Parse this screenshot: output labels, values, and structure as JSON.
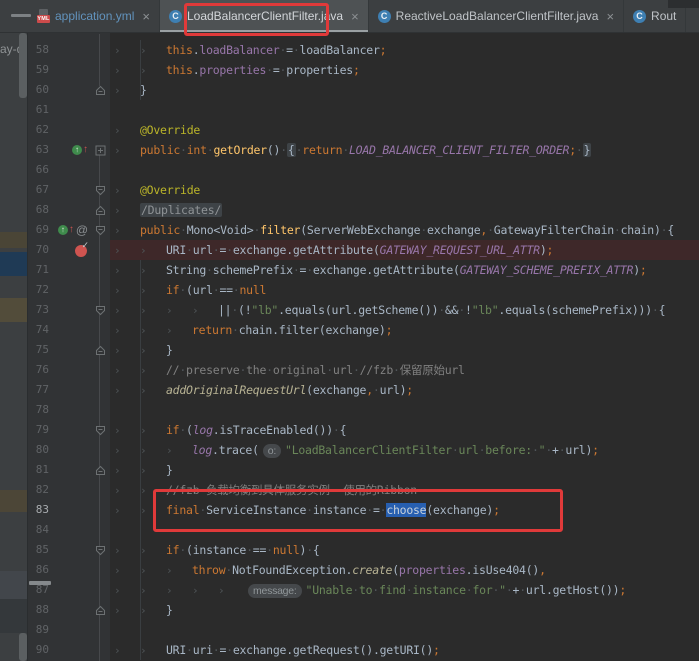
{
  "tab_bar": {
    "class_badge": "C",
    "yml_badge": "YML",
    "close_glyph": "×",
    "tabs": [
      {
        "id": "application-yml",
        "label": "application.yml",
        "icon": "yml-file-icon",
        "state": "modified",
        "closable": true
      },
      {
        "id": "load-balancer-client-filter",
        "label": "LoadBalancerClientFilter.java",
        "icon": "java-class-icon",
        "state": "active",
        "closable": true
      },
      {
        "id": "reactive-load-balancer-client-filter",
        "label": "ReactiveLoadBalancerClientFilter.java",
        "icon": "java-class-icon",
        "state": "normal",
        "closable": true
      },
      {
        "id": "rout",
        "label": "Rout",
        "icon": "java-class-icon",
        "state": "clipped",
        "closable": false
      }
    ]
  },
  "left_panel": {
    "clipped_text": "ay-de"
  },
  "annotations": {
    "color": "#e03a3a",
    "targets": [
      "tab-title-loadbalancerclientfilter",
      "code-line-83"
    ]
  },
  "editor": {
    "colors": {
      "background": "#2b2b2b",
      "gutter_background": "#313335",
      "line_number": "#606366",
      "breakpoint_line": "#3e2829",
      "selection": "#275fb0",
      "keyword": "#cc7832",
      "string": "#6a8759",
      "comment": "#808080",
      "field": "#9876aa",
      "constant_italic": "#9876aa",
      "method_declaration": "#ffc66b",
      "annotation": "#bbb529",
      "default_text": "#a9b7c6"
    },
    "lines": [
      {
        "num": "58",
        "indent": 2,
        "tokens": [
          [
            "this",
            "k"
          ],
          [
            ".",
            "d"
          ],
          [
            "loadBalancer",
            "f"
          ],
          [
            " = ",
            "d"
          ],
          [
            "loadBalancer",
            "d"
          ],
          [
            ";",
            "p"
          ]
        ]
      },
      {
        "num": "59",
        "indent": 2,
        "tokens": [
          [
            "this",
            "k"
          ],
          [
            ".",
            "d"
          ],
          [
            "properties",
            "f"
          ],
          [
            " = ",
            "d"
          ],
          [
            "properties",
            "d"
          ],
          [
            ";",
            "p"
          ]
        ]
      },
      {
        "num": "60",
        "indent": 1,
        "fold": "up",
        "tokens": [
          [
            "}",
            "d"
          ]
        ]
      },
      {
        "num": "61",
        "indent": 0,
        "tokens": []
      },
      {
        "num": "62",
        "indent": 1,
        "tokens": [
          [
            "@Override",
            "a"
          ]
        ]
      },
      {
        "num": "63",
        "indent": 1,
        "fold": "plus",
        "icons": [
          "ovr"
        ],
        "tokens": [
          [
            "public",
            "k"
          ],
          [
            " ",
            "d"
          ],
          [
            "int",
            "k"
          ],
          [
            " ",
            "d"
          ],
          [
            "getOrder",
            "m"
          ],
          [
            "() ",
            "d"
          ],
          [
            "{",
            "fold"
          ],
          [
            " ",
            "d"
          ],
          [
            "return",
            "k"
          ],
          [
            " ",
            "d"
          ],
          [
            "LOAD_BALANCER_CLIENT_FILTER_ORDER",
            "fi"
          ],
          [
            ";",
            "p"
          ],
          [
            " ",
            "d"
          ],
          [
            "}",
            "fold"
          ]
        ]
      },
      {
        "num": "66",
        "indent": 0,
        "tokens": []
      },
      {
        "num": "67",
        "indent": 1,
        "fold": "down",
        "tokens": [
          [
            "@Override",
            "a"
          ]
        ]
      },
      {
        "num": "68",
        "indent": 1,
        "fold": "up",
        "tokens": [
          [
            "/Duplicates/",
            "foldg"
          ]
        ]
      },
      {
        "num": "69",
        "indent": 1,
        "fold": "down",
        "icons": [
          "ovr",
          "at"
        ],
        "tokens": [
          [
            "public",
            "k"
          ],
          [
            " ",
            "d"
          ],
          [
            "Mono<Void> ",
            "d"
          ],
          [
            "filter",
            "m"
          ],
          [
            "(ServerWebExchange exchange",
            "d"
          ],
          [
            ",",
            "p"
          ],
          [
            " GatewayFilterChain chain) {",
            "d"
          ]
        ]
      },
      {
        "num": "70",
        "indent": 2,
        "breakpoint": true,
        "icons": [
          "bp"
        ],
        "tokens": [
          [
            "URI url = exchange.getAttribute(",
            "d"
          ],
          [
            "GATEWAY_REQUEST_URL_ATTR",
            "fi"
          ],
          [
            ")",
            "d"
          ],
          [
            ";",
            "p"
          ]
        ]
      },
      {
        "num": "71",
        "indent": 2,
        "tokens": [
          [
            "String schemePrefix = exchange.getAttribute(",
            "d"
          ],
          [
            "GATEWAY_SCHEME_PREFIX_ATTR",
            "fi"
          ],
          [
            ")",
            "d"
          ],
          [
            ";",
            "p"
          ]
        ]
      },
      {
        "num": "72",
        "indent": 2,
        "tokens": [
          [
            "if",
            "k"
          ],
          [
            " (url == ",
            "d"
          ],
          [
            "null",
            "k"
          ]
        ]
      },
      {
        "num": "73",
        "indent": 4,
        "fold": "down",
        "tokens": [
          [
            "|| (!",
            "d"
          ],
          [
            "\"lb\"",
            "s"
          ],
          [
            ".equals(url.getScheme()) && !",
            "d"
          ],
          [
            "\"lb\"",
            "s"
          ],
          [
            ".equals(schemePrefix))) {",
            "d"
          ]
        ]
      },
      {
        "num": "74",
        "indent": 3,
        "tokens": [
          [
            "return",
            "k"
          ],
          [
            " chain.filter(exchange)",
            "d"
          ],
          [
            ";",
            "p"
          ]
        ]
      },
      {
        "num": "75",
        "indent": 2,
        "fold": "up",
        "tokens": [
          [
            "}",
            "d"
          ]
        ]
      },
      {
        "num": "76",
        "indent": 2,
        "tokens": [
          [
            "// preserve the original url //fzb 保留原始url",
            "c"
          ]
        ]
      },
      {
        "num": "77",
        "indent": 2,
        "tokens": [
          [
            "addOriginalRequestUrl",
            "it"
          ],
          [
            "(exchange",
            "d"
          ],
          [
            ",",
            "p"
          ],
          [
            " url)",
            "d"
          ],
          [
            ";",
            "p"
          ]
        ]
      },
      {
        "num": "78",
        "indent": 0,
        "tokens": []
      },
      {
        "num": "79",
        "indent": 2,
        "fold": "down",
        "tokens": [
          [
            "if",
            "k"
          ],
          [
            " (",
            "d"
          ],
          [
            "log",
            "fi"
          ],
          [
            ".isTraceEnabled()) {",
            "d"
          ]
        ]
      },
      {
        "num": "80",
        "indent": 3,
        "tokens": [
          [
            "log",
            "fi"
          ],
          [
            ".trace(",
            "d"
          ],
          [
            "o:",
            "chip"
          ],
          [
            "\"LoadBalancerClientFilter url before: \"",
            "s"
          ],
          [
            " + url)",
            "d"
          ],
          [
            ";",
            "p"
          ]
        ]
      },
      {
        "num": "81",
        "indent": 2,
        "fold": "up",
        "tokens": [
          [
            "}",
            "d"
          ]
        ]
      },
      {
        "num": "82",
        "indent": 2,
        "tokens": [
          [
            "//fzb 负载均衡到具体服务实例  使用的Ribbon",
            "c"
          ]
        ]
      },
      {
        "num": "83",
        "indent": 2,
        "current": true,
        "tokens": [
          [
            "final",
            "k"
          ],
          [
            " ServiceInstance instance = ",
            "d"
          ],
          [
            "choose",
            "sel"
          ],
          [
            "(exchange)",
            "d"
          ],
          [
            ";",
            "p"
          ]
        ]
      },
      {
        "num": "84",
        "indent": 0,
        "tokens": []
      },
      {
        "num": "85",
        "indent": 2,
        "fold": "down",
        "tokens": [
          [
            "if",
            "k"
          ],
          [
            " (instance == ",
            "d"
          ],
          [
            "null",
            "k"
          ],
          [
            ") {",
            "d"
          ]
        ]
      },
      {
        "num": "86",
        "indent": 3,
        "tokens": [
          [
            "throw",
            "k"
          ],
          [
            " NotFoundException.",
            "d"
          ],
          [
            "create",
            "it"
          ],
          [
            "(",
            "d"
          ],
          [
            "properties",
            "f"
          ],
          [
            ".isUse404()",
            "d"
          ],
          [
            ",",
            "p"
          ]
        ]
      },
      {
        "num": "87",
        "indent": 5,
        "tokens": [
          [
            "message:",
            "chip"
          ],
          [
            "\"Unable to find instance for \"",
            "s"
          ],
          [
            " + url.getHost())",
            "d"
          ],
          [
            ";",
            "p"
          ]
        ]
      },
      {
        "num": "88",
        "indent": 2,
        "fold": "up",
        "tokens": [
          [
            "}",
            "d"
          ]
        ]
      },
      {
        "num": "89",
        "indent": 0,
        "tokens": []
      },
      {
        "num": "90",
        "indent": 2,
        "tokens": [
          [
            "URI uri = exchange.getRequest().getURI()",
            "d"
          ],
          [
            ";",
            "p"
          ]
        ]
      }
    ]
  }
}
